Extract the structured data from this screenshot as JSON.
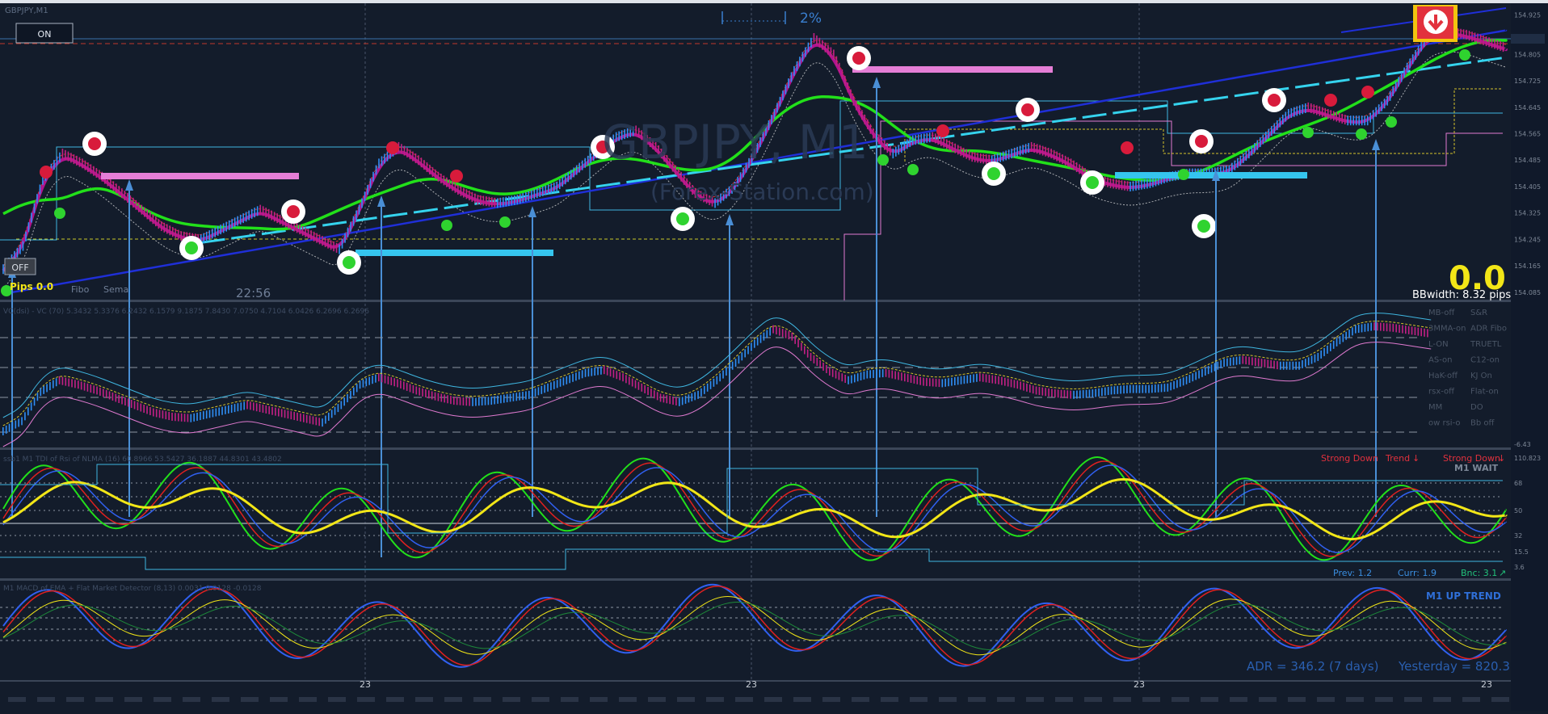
{
  "window": {
    "symbol_corner": "GBPJPY,M1",
    "on_button": "ON",
    "off_button": "OFF",
    "pips_label": "Pips 0.0",
    "fibo_label": "Fibo",
    "sema_label": "Sema",
    "time_label": "22:56",
    "pct_label": "2%",
    "watermark": "GBPJPY, M1",
    "website": "(Forex-Station.com)",
    "big_value": "0.0",
    "bbwidth": "BBwidth: 8.32 pips"
  },
  "vc_panel": {
    "header": "VC(dsi) - VC (70) 5.3432 5.3376 6.2432 6.1579 9.1875 7.8430 7.0750 4.7104 6.0426 6.2696 6.2696",
    "toggles": [
      [
        "MB-off",
        "S&R"
      ],
      [
        "3MMA-on",
        "ADR Fibo"
      ],
      [
        "L-ON",
        "TRUETL"
      ],
      [
        "AS-on",
        "C12-on"
      ],
      [
        "HaK-off",
        "KJ On"
      ],
      [
        "rsx-off",
        "Flat-on"
      ],
      [
        "MM",
        "DO"
      ],
      [
        "ow rsi-o",
        "Bb off"
      ]
    ]
  },
  "tdi_panel": {
    "header": "ssb1 M1 TDI of Rsi of NLMA (16) 60.8966 53.5427 36.1887 44.8301 43.4802",
    "strong_down_1": "Strong Down",
    "trend": "Trend",
    "strong_down_2": "Strong Down",
    "status": "M1 WAIT",
    "prev": "Prev: 1.2",
    "curr": "Curr: 1.9",
    "bnc": "Bnc: 3.1"
  },
  "macd_panel": {
    "header": "M1 MACD of EMA + Flat Market Detector (8,13) 0.0031 0.0128 -0.0128",
    "trend": "M1 UP TREND",
    "adr": "ADR = 346.2  (7 days)",
    "yesterday": "Yesterday = 820.3"
  },
  "time_axis": {
    "labels": [
      "23",
      "23",
      "23",
      "23"
    ]
  },
  "colors": {
    "bg": "#131c2b",
    "green": "#22e01a",
    "blue": "#1f2fd8",
    "magenta": "#b0138f",
    "cyan": "#35d3ee",
    "pink": "#e57ed6",
    "red_dot": "#d81b3b",
    "green_dot": "#2fd32f",
    "yellow": "#f2e617",
    "arrow": "#4a8fd6"
  },
  "chart_data": {
    "type": "line",
    "title": "GBPJPY, M1",
    "price_ticks": [
      154.925,
      154.805,
      154.725,
      154.645,
      154.565,
      154.485,
      154.405,
      154.325,
      154.245,
      154.165,
      154.085
    ],
    "ylim": [
      154.06,
      154.96
    ],
    "price_close": [
      154.15,
      154.22,
      154.42,
      154.5,
      154.47,
      154.43,
      154.38,
      154.33,
      154.28,
      154.25,
      154.24,
      154.27,
      154.3,
      154.33,
      154.3,
      154.27,
      154.24,
      154.21,
      154.33,
      154.47,
      154.52,
      154.48,
      154.43,
      154.39,
      154.36,
      154.35,
      154.36,
      154.38,
      154.4,
      154.45,
      154.5,
      154.55,
      154.57,
      154.52,
      154.45,
      154.38,
      154.35,
      154.4,
      154.5,
      154.62,
      154.75,
      154.85,
      154.8,
      154.66,
      154.56,
      154.5,
      154.54,
      154.55,
      154.52,
      154.49,
      154.48,
      154.5,
      154.52,
      154.5,
      154.47,
      154.43,
      154.41,
      154.4,
      154.41,
      154.43,
      154.44,
      154.44,
      154.45,
      154.5,
      154.56,
      154.62,
      154.64,
      154.62,
      154.6,
      154.6,
      154.66,
      154.76,
      154.85,
      154.87,
      154.86,
      154.84,
      154.82
    ],
    "series_labels": [
      "Strong Down",
      "Trend",
      "Strong Down"
    ],
    "tdi_levels": [
      110.823,
      68,
      50,
      32,
      15.5,
      3.6
    ],
    "vc_levels": [
      -6.43
    ]
  }
}
